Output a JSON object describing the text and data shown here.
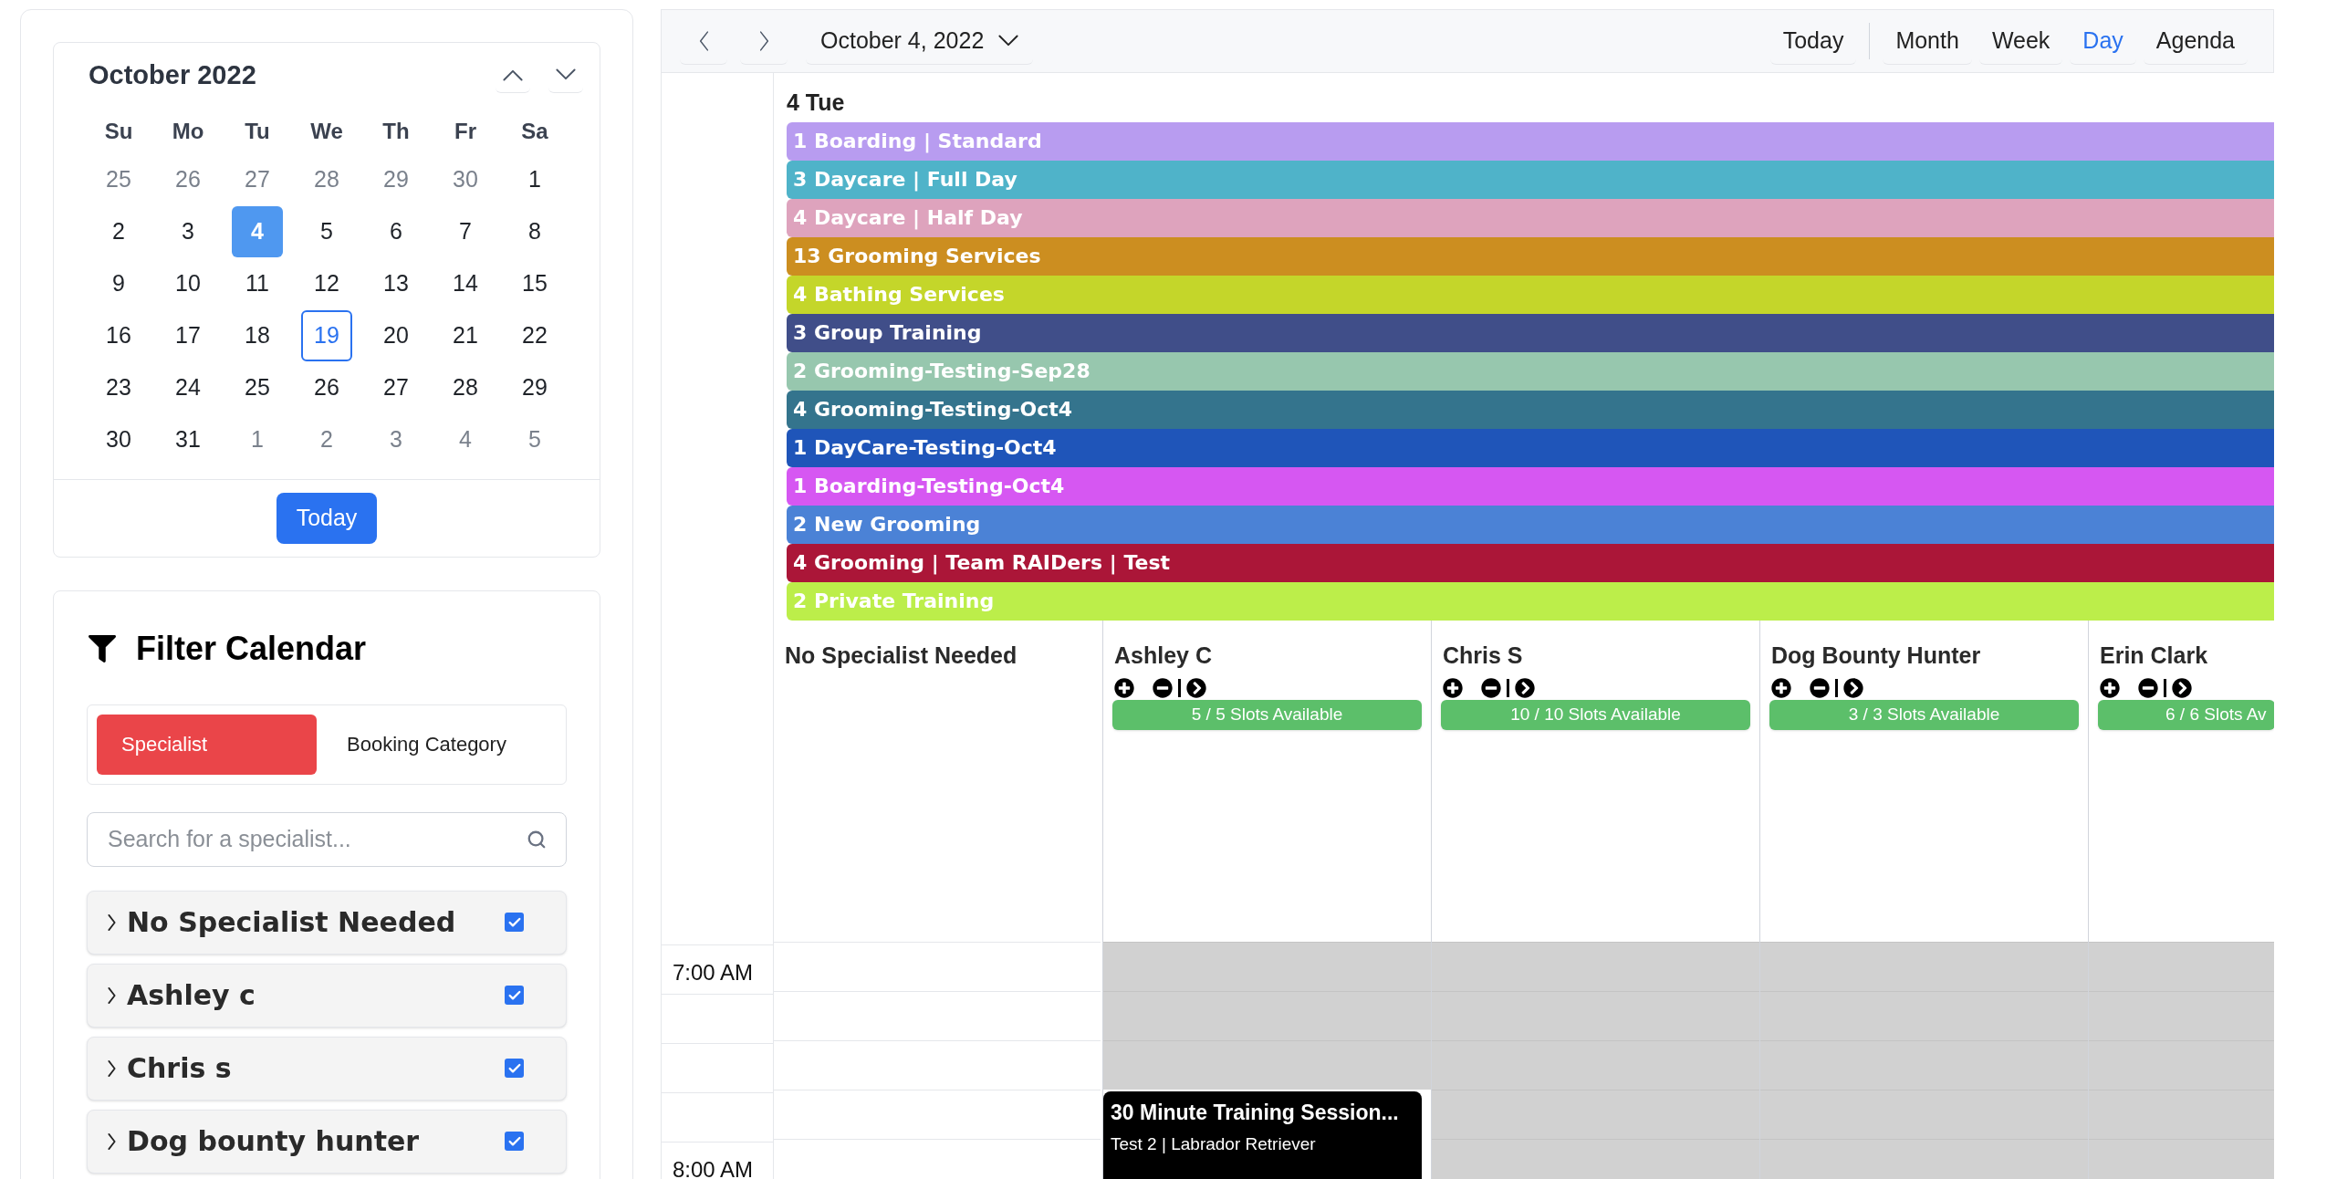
{
  "mini_calendar": {
    "title": "October 2022",
    "weekdays": [
      "Su",
      "Mo",
      "Tu",
      "We",
      "Th",
      "Fr",
      "Sa"
    ],
    "weeks": [
      [
        {
          "day": "25",
          "outside": true,
          "selected": false,
          "outlined": false
        },
        {
          "day": "26",
          "outside": true,
          "selected": false,
          "outlined": false
        },
        {
          "day": "27",
          "outside": true,
          "selected": false,
          "outlined": false
        },
        {
          "day": "28",
          "outside": true,
          "selected": false,
          "outlined": false
        },
        {
          "day": "29",
          "outside": true,
          "selected": false,
          "outlined": false
        },
        {
          "day": "30",
          "outside": true,
          "selected": false,
          "outlined": false
        },
        {
          "day": "1",
          "outside": false,
          "selected": false,
          "outlined": false
        }
      ],
      [
        {
          "day": "2",
          "outside": false,
          "selected": false,
          "outlined": false
        },
        {
          "day": "3",
          "outside": false,
          "selected": false,
          "outlined": false
        },
        {
          "day": "4",
          "outside": false,
          "selected": true,
          "outlined": false
        },
        {
          "day": "5",
          "outside": false,
          "selected": false,
          "outlined": false
        },
        {
          "day": "6",
          "outside": false,
          "selected": false,
          "outlined": false
        },
        {
          "day": "7",
          "outside": false,
          "selected": false,
          "outlined": false
        },
        {
          "day": "8",
          "outside": false,
          "selected": false,
          "outlined": false
        }
      ],
      [
        {
          "day": "9",
          "outside": false,
          "selected": false,
          "outlined": false
        },
        {
          "day": "10",
          "outside": false,
          "selected": false,
          "outlined": false
        },
        {
          "day": "11",
          "outside": false,
          "selected": false,
          "outlined": false
        },
        {
          "day": "12",
          "outside": false,
          "selected": false,
          "outlined": false
        },
        {
          "day": "13",
          "outside": false,
          "selected": false,
          "outlined": false
        },
        {
          "day": "14",
          "outside": false,
          "selected": false,
          "outlined": false
        },
        {
          "day": "15",
          "outside": false,
          "selected": false,
          "outlined": false
        }
      ],
      [
        {
          "day": "16",
          "outside": false,
          "selected": false,
          "outlined": false
        },
        {
          "day": "17",
          "outside": false,
          "selected": false,
          "outlined": false
        },
        {
          "day": "18",
          "outside": false,
          "selected": false,
          "outlined": false
        },
        {
          "day": "19",
          "outside": false,
          "selected": false,
          "outlined": true
        },
        {
          "day": "20",
          "outside": false,
          "selected": false,
          "outlined": false
        },
        {
          "day": "21",
          "outside": false,
          "selected": false,
          "outlined": false
        },
        {
          "day": "22",
          "outside": false,
          "selected": false,
          "outlined": false
        }
      ],
      [
        {
          "day": "23",
          "outside": false,
          "selected": false,
          "outlined": false
        },
        {
          "day": "24",
          "outside": false,
          "selected": false,
          "outlined": false
        },
        {
          "day": "25",
          "outside": false,
          "selected": false,
          "outlined": false
        },
        {
          "day": "26",
          "outside": false,
          "selected": false,
          "outlined": false
        },
        {
          "day": "27",
          "outside": false,
          "selected": false,
          "outlined": false
        },
        {
          "day": "28",
          "outside": false,
          "selected": false,
          "outlined": false
        },
        {
          "day": "29",
          "outside": false,
          "selected": false,
          "outlined": false
        }
      ],
      [
        {
          "day": "30",
          "outside": false,
          "selected": false,
          "outlined": false
        },
        {
          "day": "31",
          "outside": false,
          "selected": false,
          "outlined": false
        },
        {
          "day": "1",
          "outside": true,
          "selected": false,
          "outlined": false
        },
        {
          "day": "2",
          "outside": true,
          "selected": false,
          "outlined": false
        },
        {
          "day": "3",
          "outside": true,
          "selected": false,
          "outlined": false
        },
        {
          "day": "4",
          "outside": true,
          "selected": false,
          "outlined": false
        },
        {
          "day": "5",
          "outside": true,
          "selected": false,
          "outlined": false
        }
      ]
    ],
    "today_button": "Today"
  },
  "filter": {
    "title": "Filter Calendar",
    "tabs": [
      {
        "label": "Specialist",
        "selected": true
      },
      {
        "label": "Booking Category",
        "selected": false
      }
    ],
    "search": {
      "placeholder": "Search for a specialist..."
    },
    "specialists": [
      {
        "name": "No Specialist Needed",
        "checked": true
      },
      {
        "name": "Ashley c",
        "checked": true
      },
      {
        "name": "Chris s",
        "checked": true
      },
      {
        "name": "Dog bounty hunter",
        "checked": true
      }
    ]
  },
  "toolbar": {
    "date_label": "October 4, 2022",
    "today_button": "Today",
    "views": [
      {
        "label": "Month",
        "selected": false
      },
      {
        "label": "Week",
        "selected": false
      },
      {
        "label": "Day",
        "selected": true
      },
      {
        "label": "Agenda",
        "selected": false
      }
    ]
  },
  "day_header": "4 Tue",
  "all_day_events": [
    {
      "label": "1 Boarding | Standard",
      "color": "#b89cf0"
    },
    {
      "label": "3 Daycare | Full Day",
      "color": "#4fb3c9"
    },
    {
      "label": "4 Daycare | Half Day",
      "color": "#dea3bd"
    },
    {
      "label": "13 Grooming Services",
      "color": "#cc8e20"
    },
    {
      "label": "4 Bathing Services",
      "color": "#c4d62a"
    },
    {
      "label": "3 Group Training",
      "color": "#404e89"
    },
    {
      "label": "2 Grooming-Testing-Sep28",
      "color": "#97c7ae"
    },
    {
      "label": "4 Grooming-Testing-Oct4",
      "color": "#34748d"
    },
    {
      "label": "1 DayCare-Testing-Oct4",
      "color": "#1f55b9"
    },
    {
      "label": "1 Boarding-Testing-Oct4",
      "color": "#d657f2"
    },
    {
      "label": "2 New Grooming",
      "color": "#4b82d6"
    },
    {
      "label": "4 Grooming | Team RAIDers | Test",
      "color": "#ab1638"
    },
    {
      "label": "2 Private Training",
      "color": "#bcee4a"
    }
  ],
  "resources": [
    {
      "name": "No Specialist Needed",
      "available": true
    },
    {
      "name": "Ashley C",
      "slots": "5 / 5 Slots Available",
      "available": false,
      "events": [
        {
          "title": "30 Minute Training Session...",
          "subtitle": "Test 2 | Labrador Retriever"
        }
      ]
    },
    {
      "name": "Chris S",
      "slots": "10 / 10 Slots Available",
      "available": false
    },
    {
      "name": "Dog Bounty Hunter",
      "slots": "3 / 3 Slots Available",
      "available": false
    },
    {
      "name": "Erin Clark",
      "slots": "6 / 6 Slots Av",
      "available": false
    }
  ],
  "hours": [
    "7:00 AM",
    "8:00 AM"
  ]
}
